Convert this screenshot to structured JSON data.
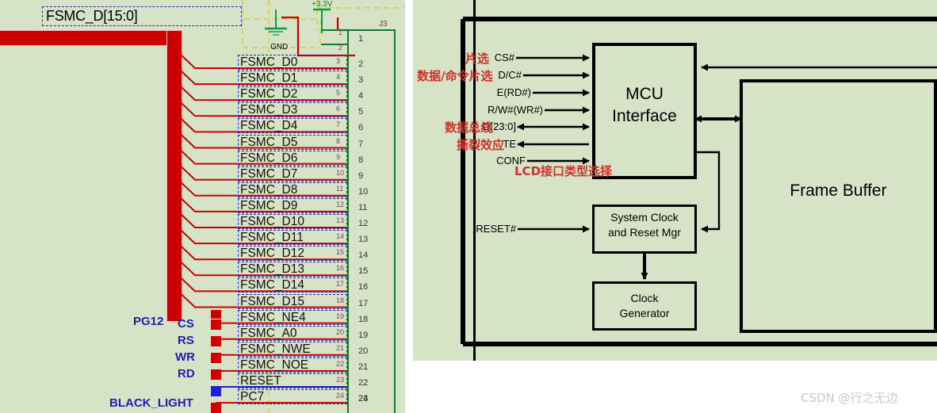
{
  "left_schematic": {
    "bus_label": "FSMC_D[15:0]",
    "power_label": "+3.3V",
    "gnd_label": "GND",
    "connector_designator": "J3",
    "net_rows": [
      {
        "net": "FSMC_D0",
        "pin_small": "3",
        "pin_big": "2"
      },
      {
        "net": "FSMC_D1",
        "pin_small": "4",
        "pin_big": "3"
      },
      {
        "net": "FSMC_D2",
        "pin_small": "5",
        "pin_big": "4"
      },
      {
        "net": "FSMC_D3",
        "pin_small": "6",
        "pin_big": "5"
      },
      {
        "net": "FSMC_D4",
        "pin_small": "7",
        "pin_big": "6"
      },
      {
        "net": "FSMC_D5",
        "pin_small": "8",
        "pin_big": "7"
      },
      {
        "net": "FSMC_D6",
        "pin_small": "9",
        "pin_big": "8"
      },
      {
        "net": "FSMC_D7",
        "pin_small": "10",
        "pin_big": "9"
      },
      {
        "net": "FSMC_D8",
        "pin_small": "11",
        "pin_big": "10"
      },
      {
        "net": "FSMC_D9",
        "pin_small": "12",
        "pin_big": "11"
      },
      {
        "net": "FSMC_D10",
        "pin_small": "13",
        "pin_big": "12"
      },
      {
        "net": "FSMC_D11",
        "pin_small": "14",
        "pin_big": "13"
      },
      {
        "net": "FSMC_D12",
        "pin_small": "15",
        "pin_big": "14"
      },
      {
        "net": "FSMC_D13",
        "pin_small": "16",
        "pin_big": "15"
      },
      {
        "net": "FSMC_D14",
        "pin_small": "17",
        "pin_big": "16"
      },
      {
        "net": "FSMC_D15",
        "pin_small": "18",
        "pin_big": "17"
      },
      {
        "net": "FSMC_NE4",
        "pin_small": "19",
        "pin_big": "18"
      },
      {
        "net": "FSMC_A0",
        "pin_small": "20",
        "pin_big": "19"
      },
      {
        "net": "FSMC_NWE",
        "pin_small": "21",
        "pin_big": "20"
      },
      {
        "net": "FSMC_NOE",
        "pin_small": "22",
        "pin_big": "21"
      },
      {
        "net": "RESET",
        "pin_small": "23",
        "pin_big": "22"
      },
      {
        "net": "PC7",
        "pin_small": "24",
        "pin_big": "23"
      }
    ],
    "top_pins": [
      {
        "pin_small": "1",
        "pin_big": "1"
      },
      {
        "pin_small": "2",
        "pin_big": ""
      }
    ],
    "extra_pin_big": "24",
    "signal_labels": [
      {
        "text": "CS"
      },
      {
        "text": "RS"
      },
      {
        "text": "WR"
      },
      {
        "text": "RD"
      }
    ],
    "port_labels": [
      {
        "text": "PG12"
      },
      {
        "text": "BLACK_LIGHT"
      }
    ]
  },
  "right_diagram": {
    "blocks": [
      {
        "id": "mcu",
        "title": "MCU\nInterface"
      },
      {
        "id": "frame",
        "title": "Frame Buffer"
      },
      {
        "id": "clk",
        "title": "System Clock\nand Reset Mgr"
      },
      {
        "id": "gen",
        "title": "Clock\nGenerator"
      }
    ],
    "signals": [
      {
        "name": "CS#",
        "dir": "in"
      },
      {
        "name": "D/C#",
        "dir": "in"
      },
      {
        "name": "E(RD#)",
        "dir": "in"
      },
      {
        "name": "R/W#(WR#)",
        "dir": "in"
      },
      {
        "name": "D[23:0]",
        "dir": "bidir"
      },
      {
        "name": "TE",
        "dir": "out"
      },
      {
        "name": "CONF",
        "dir": "in"
      },
      {
        "name": "RESET#",
        "dir": "in"
      }
    ],
    "annotations": [
      {
        "text": "片选"
      },
      {
        "text": "数据/命令片选"
      },
      {
        "text": "数据总线"
      },
      {
        "text": "撕裂效应"
      },
      {
        "text": "LCD接口类型选择"
      }
    ]
  },
  "watermark": {
    "text": "CSDN @行之无边"
  },
  "colors": {
    "background": "#d7e3c6",
    "bus_red": "#cc0000",
    "wire_green": "#0a7d2e",
    "net_blue": "#2222cc",
    "annotation_red": "#d1302a",
    "page_white": "#ffffff"
  }
}
